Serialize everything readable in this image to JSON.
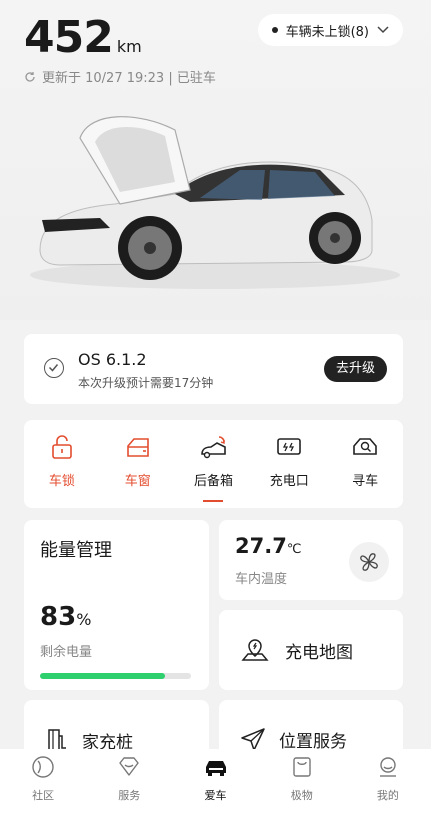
{
  "header": {
    "range_value": "452",
    "range_unit": "km",
    "updated_text": "更新于 10/27 19:23 | 已驻车",
    "lock_status": "车辆未上锁(8)"
  },
  "ota": {
    "version": "OS 6.1.2",
    "subtitle": "本次升级预计需要17分钟",
    "upgrade_label": "去升级"
  },
  "controls": [
    {
      "label": "车锁",
      "icon": "lock-icon",
      "active": true
    },
    {
      "label": "车窗",
      "icon": "window-icon",
      "active": true
    },
    {
      "label": "后备箱",
      "icon": "trunk-icon",
      "active": false,
      "selected": true
    },
    {
      "label": "充电口",
      "icon": "charge-port-icon",
      "active": false
    },
    {
      "label": "寻车",
      "icon": "find-car-icon",
      "active": false
    }
  ],
  "energy": {
    "title": "能量管理",
    "percent": "83",
    "percent_unit": "%",
    "label": "剩余电量",
    "level": 0.83
  },
  "climate": {
    "temp": "27.7",
    "unit": "℃",
    "label": "车内温度"
  },
  "charging_map": {
    "label": "充电地图"
  },
  "wallbox": {
    "label": "家充桩"
  },
  "location": {
    "label": "位置服务"
  },
  "tabs": [
    {
      "label": "社区",
      "icon": "community-icon",
      "active": false
    },
    {
      "label": "服务",
      "icon": "service-icon",
      "active": false
    },
    {
      "label": "爱车",
      "icon": "car-icon",
      "active": true
    },
    {
      "label": "极物",
      "icon": "shop-icon",
      "active": false
    },
    {
      "label": "我的",
      "icon": "profile-icon",
      "active": false
    }
  ],
  "colors": {
    "accent": "#e34d2f",
    "battery": "#2ecf6d"
  }
}
